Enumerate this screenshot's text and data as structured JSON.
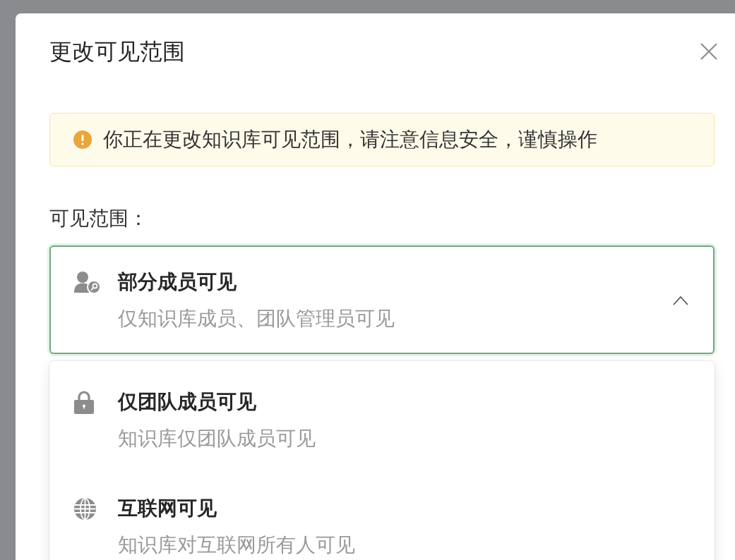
{
  "dialog": {
    "title": "更改可见范围"
  },
  "alert": {
    "kind": "warning",
    "text": "你正在更改知识库可见范围，请注意信息安全，谨慎操作"
  },
  "visibility": {
    "label": "可见范围：",
    "expanded": true,
    "current": {
      "kind": "members",
      "title": "部分成员可见",
      "description": "仅知识库成员、团队管理员可见"
    },
    "options": [
      {
        "kind": "team",
        "title": "仅团队成员可见",
        "description": "知识库仅团队成员可见"
      },
      {
        "kind": "internet",
        "title": "互联网可见",
        "description": "知识库对互联网所有人可见"
      }
    ]
  }
}
